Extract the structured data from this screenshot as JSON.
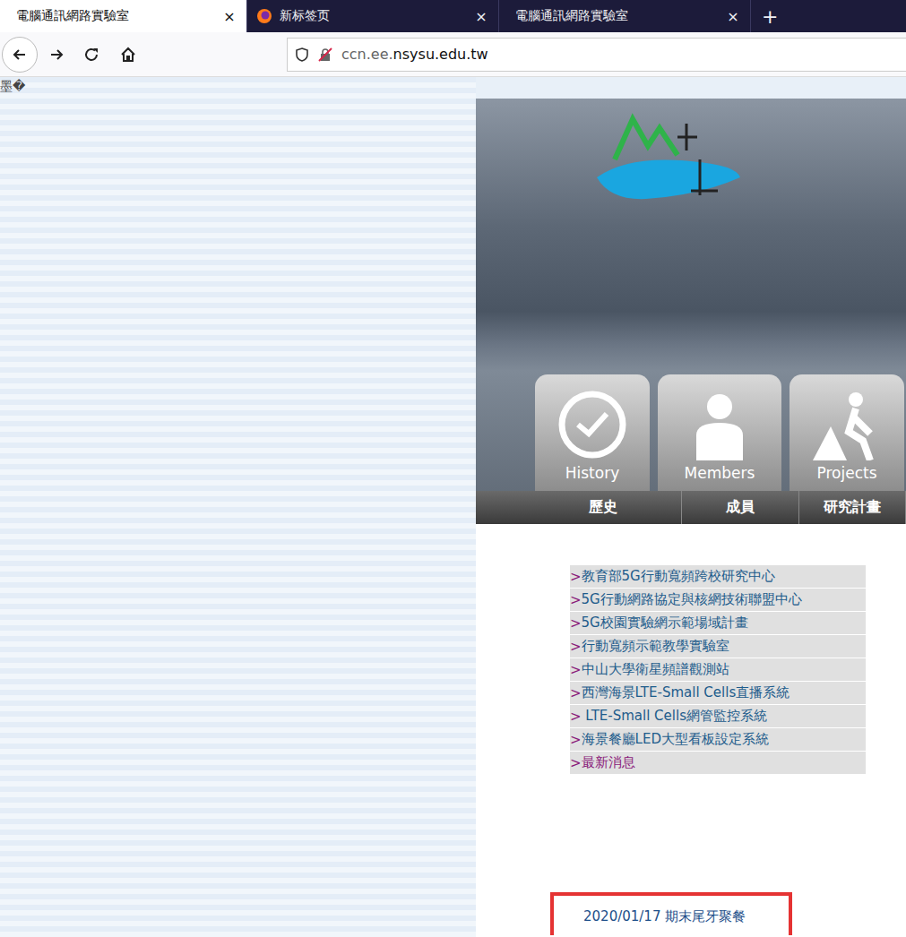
{
  "tabs": [
    {
      "label": "電腦通訊網路實驗室",
      "close": "×",
      "selected": true,
      "kind": "site"
    },
    {
      "label": "新标签页",
      "close": "×",
      "selected": false,
      "kind": "firefox"
    },
    {
      "label": "電腦通訊網路實驗室",
      "close": "×",
      "selected": false,
      "kind": "site"
    }
  ],
  "new_tab": "+",
  "address": {
    "prefix": "ccn.ee.",
    "domain": "nsysu.edu.tw"
  },
  "page": {
    "garbled": "墨�",
    "nav_tiles": [
      {
        "label": "History",
        "sub": "歷史",
        "icon": "clock"
      },
      {
        "label": "Members",
        "sub": "成員",
        "icon": "person"
      },
      {
        "label": "Projects",
        "sub": "研究計畫",
        "icon": "worker"
      }
    ],
    "links": [
      {
        "bullet": ">",
        "text": "教育部5G行動寬頻跨校研究中心",
        "visited": false
      },
      {
        "bullet": ">",
        "text": "5G行動網路協定與核網技術聯盟中心",
        "visited": false
      },
      {
        "bullet": ">",
        "text": "5G校園實驗網示範場域計畫",
        "visited": false
      },
      {
        "bullet": ">",
        "text": "行動寬頻示範教學實驗室",
        "visited": false
      },
      {
        "bullet": ">",
        "text": "中山大學衛星頻譜觀測站",
        "visited": false
      },
      {
        "bullet": ">",
        "text": "西灣海景LTE-Small Cells直播系統",
        "visited": false
      },
      {
        "bullet": ">",
        "text": " LTE-Small Cells網管監控系統",
        "visited": false
      },
      {
        "bullet": ">",
        "text": "海景餐廳LED大型看板設定系統",
        "visited": false
      },
      {
        "bullet": ">",
        "text": "最新消息",
        "visited": true
      }
    ],
    "news": [
      {
        "text": "2020/01/17 期末尾牙聚餐",
        "highlighted": true
      }
    ]
  }
}
